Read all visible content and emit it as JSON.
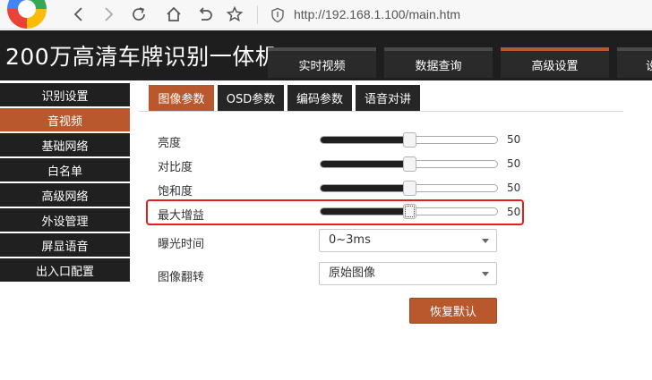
{
  "browser": {
    "url": "http://192.168.1.100/main.htm"
  },
  "header": {
    "title": "200万高清车牌识别一体机",
    "tabs": [
      {
        "label": "实时视频"
      },
      {
        "label": "数据查询"
      },
      {
        "label": "高级设置",
        "active": true
      },
      {
        "label": "设"
      }
    ]
  },
  "sidebar": {
    "items": [
      {
        "label": "识别设置"
      },
      {
        "label": "音视频",
        "active": true
      },
      {
        "label": "基础网络"
      },
      {
        "label": "白名单"
      },
      {
        "label": "高级网络"
      },
      {
        "label": "外设管理"
      },
      {
        "label": "屏显语音"
      },
      {
        "label": "出入口配置"
      }
    ]
  },
  "subtabs": [
    {
      "label": "图像参数",
      "active": true
    },
    {
      "label": "OSD参数"
    },
    {
      "label": "编码参数"
    },
    {
      "label": "语音对讲"
    }
  ],
  "image_params": {
    "sliders": [
      {
        "label": "亮度",
        "value": "50",
        "level": 0.5
      },
      {
        "label": "对比度",
        "value": "50",
        "level": 0.5
      },
      {
        "label": "饱和度",
        "value": "50",
        "level": 0.5
      },
      {
        "label": "最大增益",
        "value": "50",
        "level": 0.5,
        "highlighted": true
      }
    ],
    "exposure": {
      "label": "曝光时间",
      "value": "0~3ms"
    },
    "flip": {
      "label": "图像翻转",
      "value": "原始图像"
    },
    "restore_label": "恢复默认"
  },
  "colors": {
    "accent": "#b8582c",
    "dark": "#1e1e1e",
    "highlight": "#e02020"
  }
}
